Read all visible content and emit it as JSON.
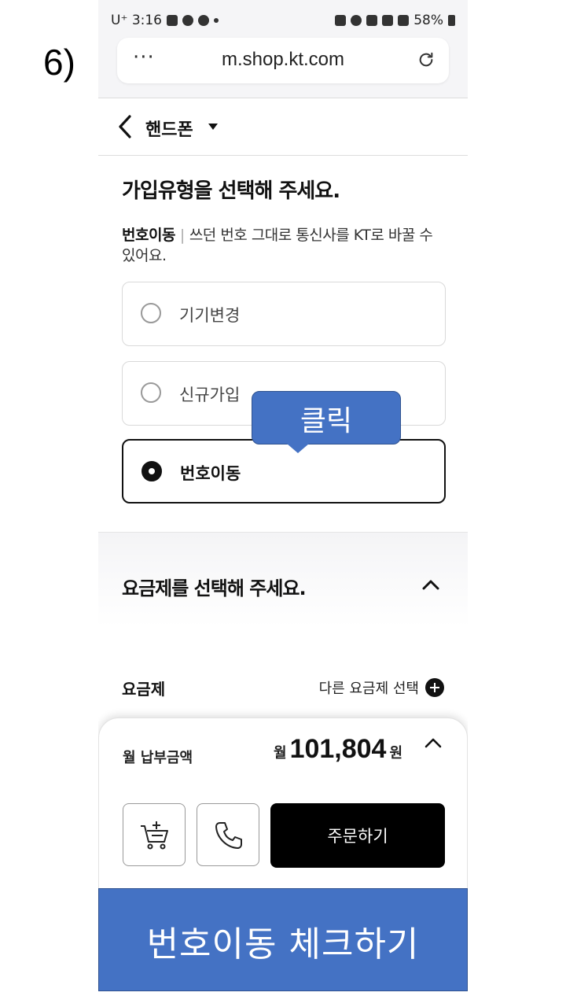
{
  "step_label": "6)",
  "status_bar": {
    "carrier_time": "U⁺ 3:16",
    "battery": "58%",
    "left_icons": [
      "gallery-icon",
      "link-icon",
      "talk-icon"
    ],
    "right_icons": [
      "nfc-icon",
      "alarm-icon",
      "mute-icon",
      "5g-icon",
      "signal-icon",
      "battery-icon"
    ]
  },
  "browser": {
    "url": "m.shop.kt.com",
    "more_label": "···"
  },
  "nav": {
    "title": "핸드폰"
  },
  "join_type": {
    "title": "가입유형을 선택해 주세요.",
    "desc_bold": "번호이동",
    "desc_sep": "|",
    "desc_text": "쓰던 번호 그대로 통신사를 KT로 바꿀 수 있어요.",
    "options": [
      {
        "label": "기기변경",
        "selected": false
      },
      {
        "label": "신규가입",
        "selected": false
      },
      {
        "label": "번호이동",
        "selected": true
      }
    ]
  },
  "callout": {
    "text": "클릭",
    "color": "#4472c4"
  },
  "plan": {
    "title": "요금제를 선택해 주세요.",
    "label": "요금제",
    "other_plan": "다른 요금제 선택"
  },
  "payment": {
    "label": "월 납부금액",
    "prefix": "월",
    "amount": "101,804",
    "suffix": "원",
    "order_button": "주문하기"
  },
  "banner": {
    "text": "번호이동 체크하기",
    "color": "#4472c4"
  }
}
